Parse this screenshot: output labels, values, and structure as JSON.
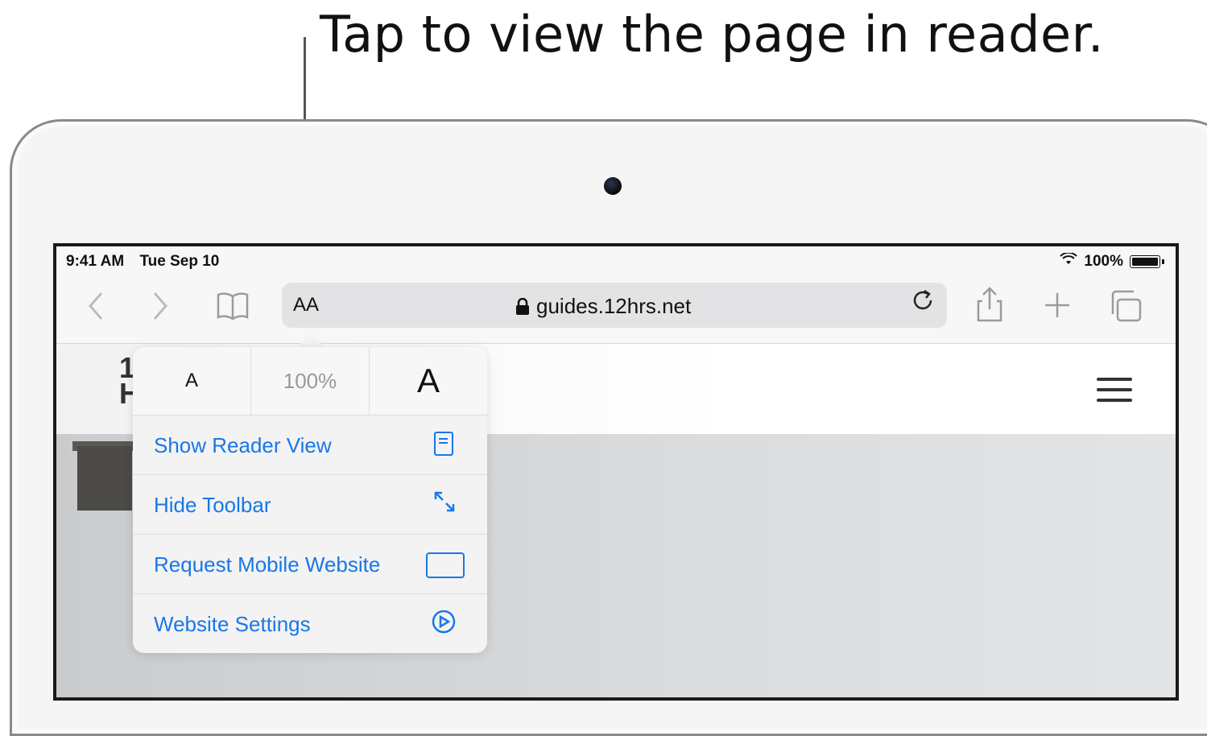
{
  "callout": {
    "text": "Tap to view the page in reader."
  },
  "status_bar": {
    "time": "9:41 AM",
    "date": "Tue Sep 10",
    "battery": "100%"
  },
  "toolbar": {
    "text_size_button": "AA",
    "address": "guides.12hrs.net",
    "back_icon": "chevron-left-icon",
    "forward_icon": "chevron-right-icon",
    "bookmarks_icon": "book-icon",
    "share_icon": "share-icon",
    "new_tab_icon": "plus-icon",
    "tabs_icon": "tabs-icon",
    "reload_icon": "reload-icon"
  },
  "site": {
    "logo_line1": "1",
    "logo_line2": "H"
  },
  "popover": {
    "font_smaller": "A",
    "zoom": "100%",
    "font_larger": "A",
    "items": [
      {
        "label": "Show Reader View",
        "icon": "reader-icon"
      },
      {
        "label": "Hide Toolbar",
        "icon": "expand-icon"
      },
      {
        "label": "Request Mobile Website",
        "icon": "device-icon"
      },
      {
        "label": "Website Settings",
        "icon": "settings-icon"
      }
    ]
  },
  "colors": {
    "accent": "#1977e8"
  }
}
